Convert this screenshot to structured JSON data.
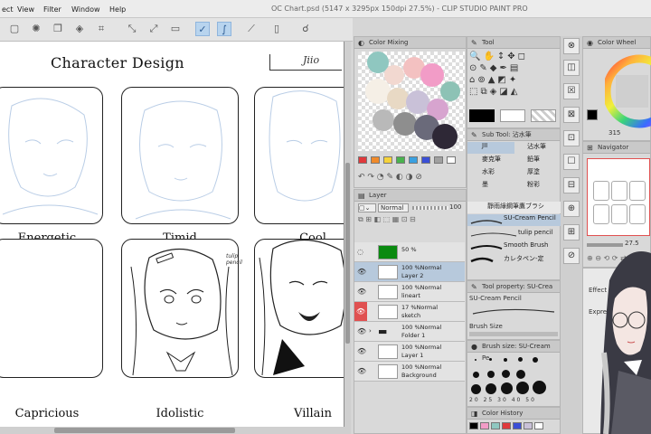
{
  "menu": {
    "items": [
      "ect",
      "View",
      "Filter",
      "Window",
      "Help"
    ],
    "title": "OC Chart.psd (5147 x 3295px 150dpi 27.5%) - CLIP STUDIO PAINT PRO"
  },
  "canvas": {
    "title": "Character Design",
    "signature": "Jiio",
    "cells": [
      {
        "label": "Energetic"
      },
      {
        "label": "Timid"
      },
      {
        "label": "Cool"
      },
      {
        "label": "Capricious"
      },
      {
        "label": "Idolistic"
      },
      {
        "label": "Villain"
      }
    ],
    "note": "tulip pencil"
  },
  "color_mixing": {
    "title": "Color Mixing",
    "palette": [
      "#e0393c",
      "#f08a2a",
      "#f5d23a",
      "#49b24e",
      "#3aa0e0",
      "#3a4fd6",
      "#a0a0a0",
      "#ffffff"
    ]
  },
  "tool": {
    "title": "Tool"
  },
  "sub_tool": {
    "title": "Sub Tool: 沾水筆",
    "tabs": [
      "JII",
      "沾水筆",
      "麥克筆",
      "鉛筆",
      "水彩",
      "厚塗",
      "墨",
      "粉彩"
    ],
    "brushes": [
      "靜雨綠鋼筆鷹ブラシ",
      "SU-Cream Pencil",
      "tulip pencil",
      "Smooth Brush",
      "カレタペン-定"
    ]
  },
  "tool_property": {
    "title": "Tool property: SU-Crea",
    "brush_name": "SU-Cream Pencil",
    "brush_size_label": "Brush Size"
  },
  "brush_size": {
    "title": "Brush size: SU-Cream Pe",
    "sizes": [
      "1",
      "2",
      "3",
      "5",
      "7",
      "10",
      "12",
      "15",
      "17",
      "20",
      "25",
      "30",
      "40",
      "50",
      "60"
    ]
  },
  "color_history": {
    "title": "Color History"
  },
  "color_wheel": {
    "title": "Color Wheel",
    "value": "315"
  },
  "navigator": {
    "title": "Navigator",
    "zoom": "27.5"
  },
  "layer": {
    "title": "Layer",
    "blend": "Normal",
    "opacity": "100",
    "rows": [
      {
        "name": "50 %",
        "sub": "",
        "selected": false
      },
      {
        "name": "100 %Normal",
        "sub": "Layer 2",
        "selected": true
      },
      {
        "name": "100 %Normal",
        "sub": "lineart",
        "selected": false
      },
      {
        "name": "17 %Normal",
        "sub": "sketch",
        "selected": false
      },
      {
        "name": "100 %Normal",
        "sub": "Folder 1",
        "selected": false
      },
      {
        "name": "100 %Normal",
        "sub": "Layer 1",
        "selected": false
      },
      {
        "name": "100 %Normal",
        "sub": "Background",
        "selected": false
      }
    ]
  },
  "effect": {
    "label": "Effect",
    "expr_label": "Expre"
  },
  "colors": {
    "accent": "#8fb5dd",
    "primary": "#000000",
    "secondary": "#ffffff"
  }
}
